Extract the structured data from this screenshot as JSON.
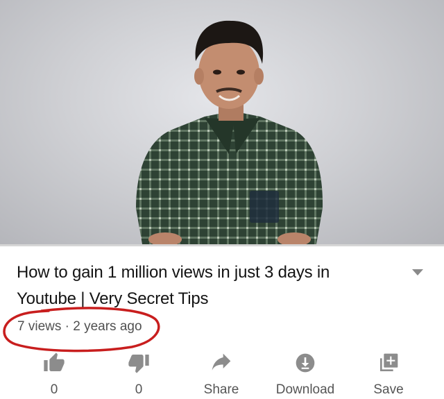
{
  "video": {
    "title": "How to gain 1 million views in just 3 days in Youtube | Very Secret Tips",
    "views": "7 views",
    "separator": "·",
    "age": "2 years ago"
  },
  "actions": [
    {
      "name": "like",
      "label": "0",
      "icon": "thumbs-up-icon"
    },
    {
      "name": "dislike",
      "label": "0",
      "icon": "thumbs-down-icon"
    },
    {
      "name": "share",
      "label": "Share",
      "icon": "share-arrow-icon"
    },
    {
      "name": "download",
      "label": "Download",
      "icon": "download-icon"
    },
    {
      "name": "save",
      "label": "Save",
      "icon": "playlist-add-icon"
    }
  ],
  "colors": {
    "annotation_circle": "#c81e1e",
    "icon_gray": "#8c8c8c",
    "stats_text": "#505050"
  }
}
